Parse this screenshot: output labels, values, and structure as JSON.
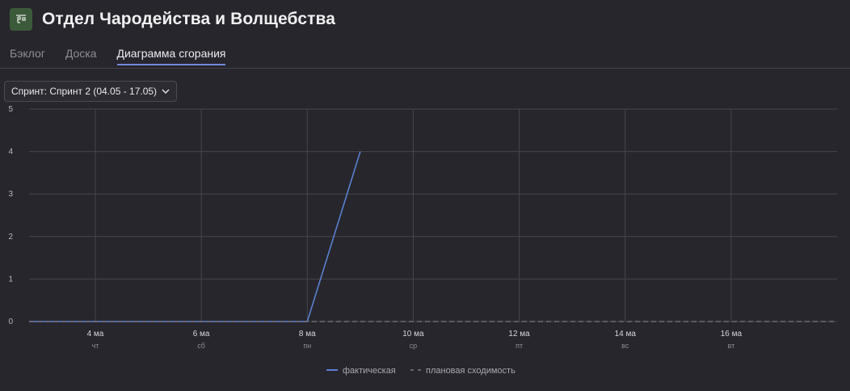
{
  "header": {
    "title": "Отдел Чародейства и Волщебства",
    "icon": "board-icon"
  },
  "tabs": [
    {
      "label": "Бэклог",
      "active": false
    },
    {
      "label": "Доска",
      "active": false
    },
    {
      "label": "Диаграмма сгорания",
      "active": true
    }
  ],
  "sprint_select": {
    "value": "Спринт: Спринт 2 (04.05 - 17.05)"
  },
  "colors": {
    "actual": "#5b7fd1",
    "planned": "#7b7a82",
    "grid": "#46454d",
    "accent": "#6f8ad6"
  },
  "chart_data": {
    "type": "line",
    "ylim": [
      0,
      5
    ],
    "yticks": [
      0,
      1,
      2,
      3,
      4,
      5
    ],
    "xlim": [
      "2023-05-02T18:00",
      "2023-05-17T23:59"
    ],
    "xticks": [
      {
        "date": "2023-05-04",
        "label": "4 ма",
        "sub": "чт"
      },
      {
        "date": "2023-05-06",
        "label": "6 ма",
        "sub": "сб"
      },
      {
        "date": "2023-05-08",
        "label": "8 ма",
        "sub": "пн"
      },
      {
        "date": "2023-05-10",
        "label": "10 ма",
        "sub": "ср"
      },
      {
        "date": "2023-05-12",
        "label": "12 ма",
        "sub": "пт"
      },
      {
        "date": "2023-05-14",
        "label": "14 ма",
        "sub": "вс"
      },
      {
        "date": "2023-05-16",
        "label": "16 ма",
        "sub": "вт"
      }
    ],
    "series": [
      {
        "name": "фактическая",
        "style": "solid",
        "points": [
          {
            "x": "2023-05-02T18:00",
            "y": 0
          },
          {
            "x": "2023-05-08",
            "y": 0
          },
          {
            "x": "2023-05-09",
            "y": 4
          }
        ]
      },
      {
        "name": "плановая сходимость",
        "style": "dashed",
        "points": [
          {
            "x": "2023-05-02T18:00",
            "y": 0
          },
          {
            "x": "2023-05-17T23:59",
            "y": 0
          }
        ]
      }
    ],
    "grid": true,
    "legend": "bottom-center"
  }
}
